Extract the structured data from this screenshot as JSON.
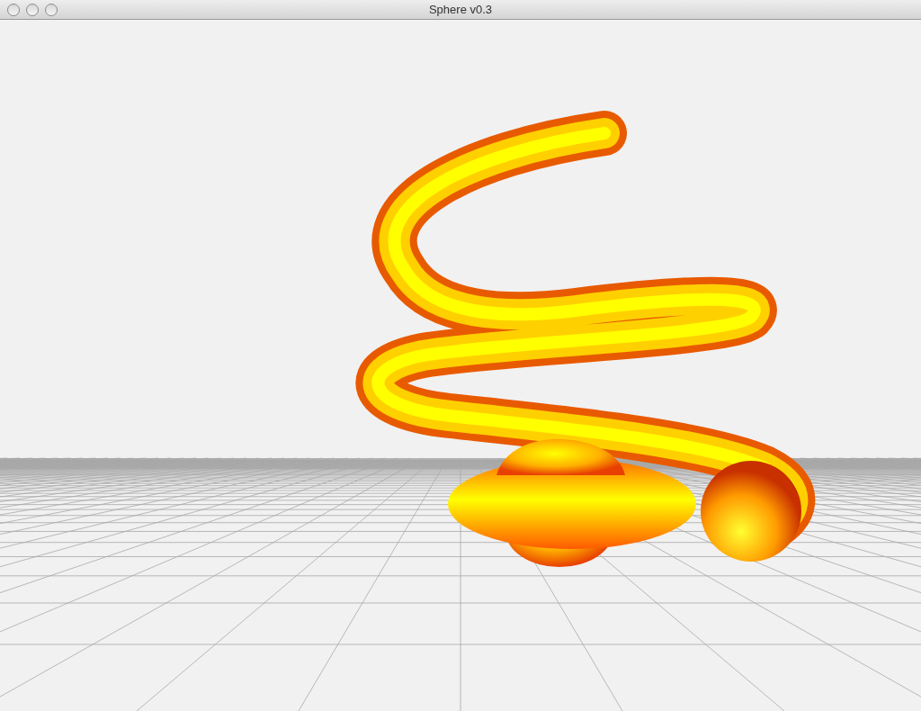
{
  "window": {
    "title": "Sphere v0.3"
  }
}
